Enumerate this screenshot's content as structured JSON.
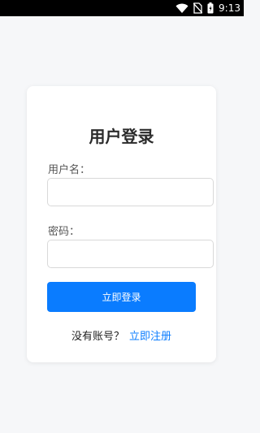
{
  "status_bar": {
    "time": "9:13",
    "icons": [
      "wifi-icon",
      "no-sim-icon",
      "battery-charging-icon"
    ]
  },
  "login": {
    "title": "用户登录",
    "username_label": "用户名：",
    "username_value": "",
    "password_label": "密码：",
    "password_value": "",
    "submit_label": "立即登录",
    "no_account_text": "没有账号？",
    "register_link": "立即注册"
  },
  "colors": {
    "accent": "#0a7cff",
    "background": "#f6f7f9",
    "card": "#ffffff"
  }
}
